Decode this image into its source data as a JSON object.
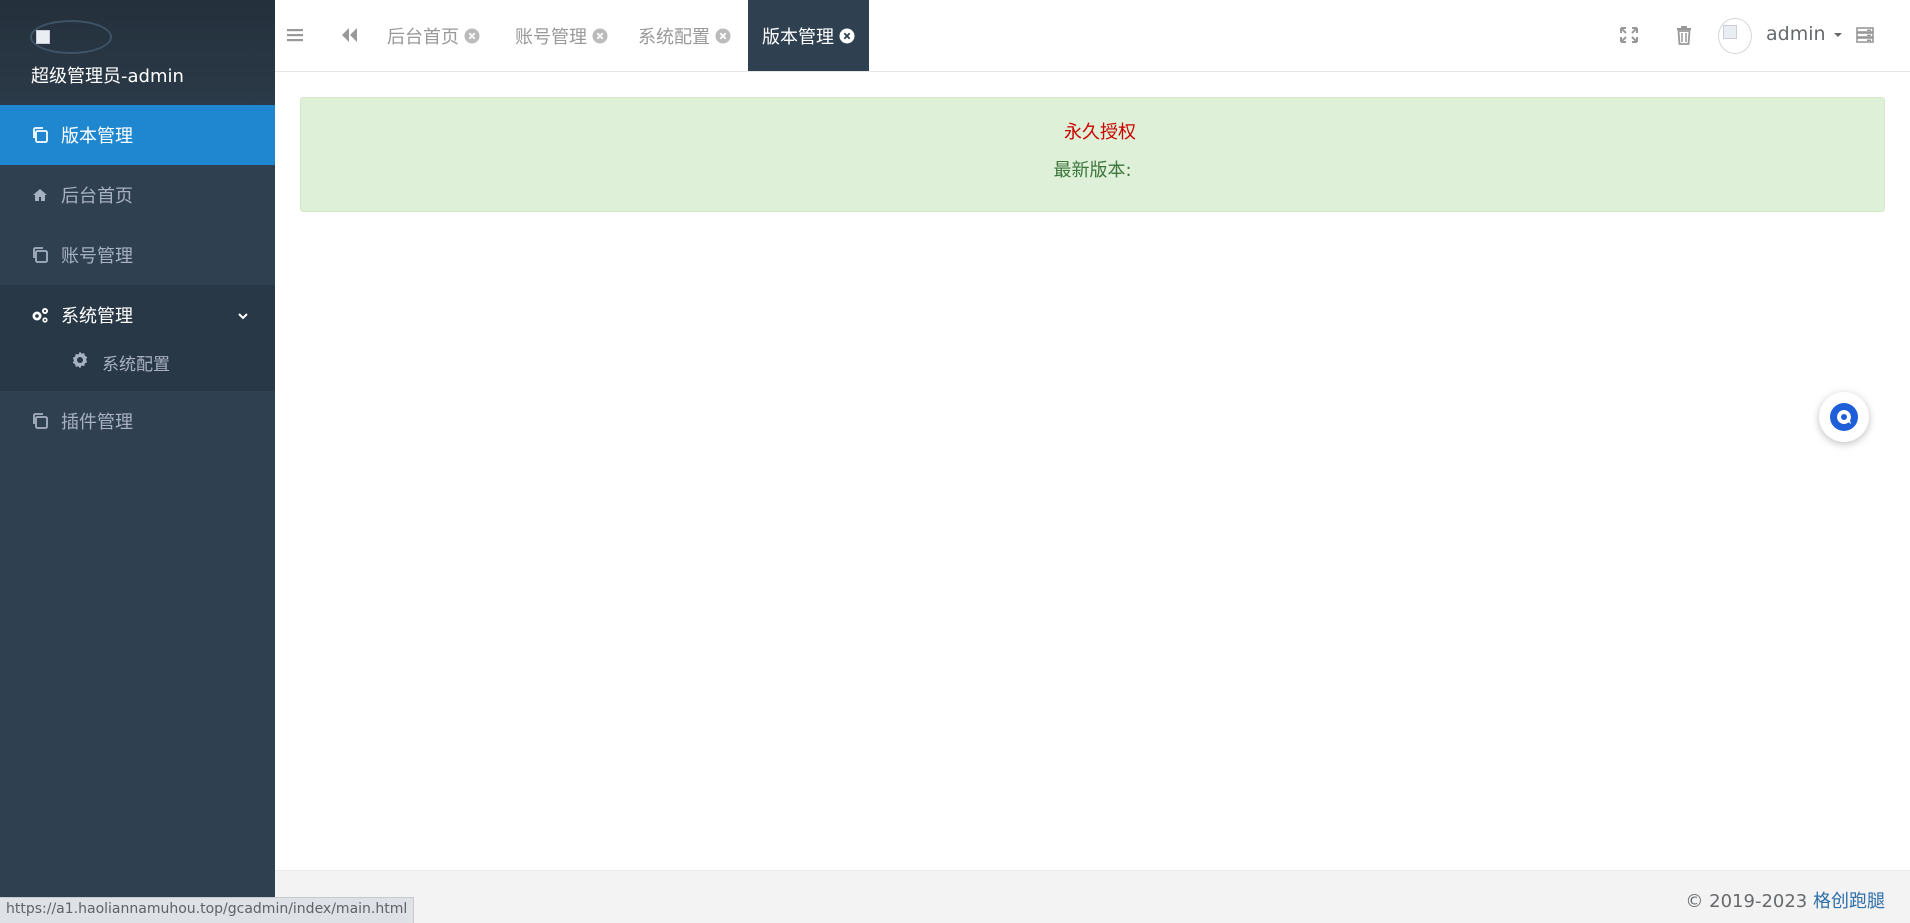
{
  "sidebar": {
    "logo_alt": "image",
    "user_name": "超级管理员-admin",
    "items": [
      {
        "label": "版本管理",
        "icon": "copy-icon",
        "active": true
      },
      {
        "label": "后台首页",
        "icon": "home-icon"
      },
      {
        "label": "账号管理",
        "icon": "copy-icon"
      },
      {
        "label": "系统管理",
        "icon": "cogs-icon",
        "expanded": true,
        "children": [
          {
            "label": "系统配置",
            "icon": "gear-icon"
          }
        ]
      },
      {
        "label": "插件管理",
        "icon": "copy-icon"
      }
    ]
  },
  "topbar": {
    "tabs": [
      {
        "label": "后台首页"
      },
      {
        "label": "账号管理"
      },
      {
        "label": "系统配置"
      },
      {
        "label": "版本管理",
        "active": true
      }
    ],
    "user": "admin"
  },
  "main": {
    "alert_title": "永久授权",
    "version_label": "最新版本:"
  },
  "footer": {
    "copyright": "© 2019-2023",
    "brand": "格创跑腿"
  },
  "status_url": "https://a1.haoliannamuhou.top/gcadmin/index/main.html",
  "colors": {
    "sidebar_bg": "#2f4050",
    "active_blue": "#1e87d0",
    "alert_bg": "#dff0d8",
    "alert_title": "#cc0000",
    "alert_text": "#3c763d",
    "brand_link": "#2f6fa8"
  }
}
